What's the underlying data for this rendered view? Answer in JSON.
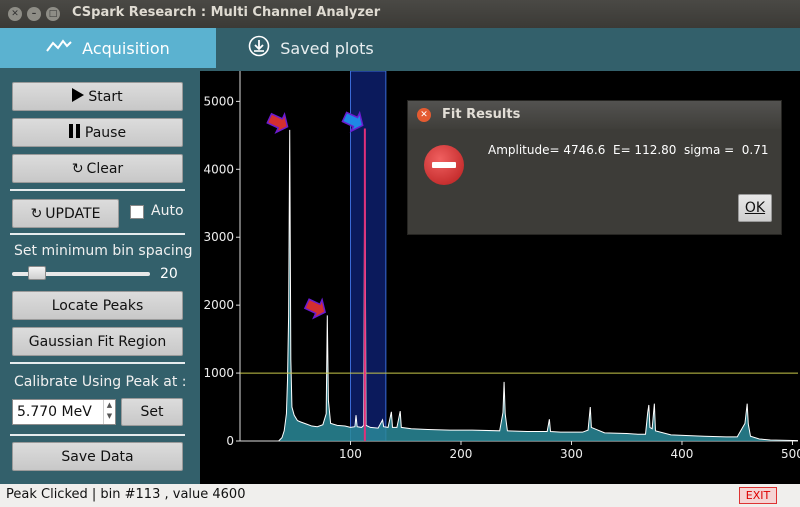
{
  "window": {
    "title": "CSpark Research : Multi Channel Analyzer"
  },
  "tabs": [
    {
      "label": "Acquisition",
      "icon": "line-chart-icon",
      "active": true
    },
    {
      "label": "Saved plots",
      "icon": "download-icon",
      "active": false
    }
  ],
  "sidebar": {
    "start_label": "Start",
    "pause_label": "Pause",
    "clear_label": "Clear",
    "update_label": "UPDATE",
    "auto_label": "Auto",
    "auto_checked": false,
    "bin_spacing_label": "Set minimum bin spacing",
    "bin_spacing_value": "20",
    "locate_peaks_label": "Locate Peaks",
    "gaussian_fit_label": "Gaussian Fit Region",
    "calibrate_label": "Calibrate Using Peak at :",
    "calibrate_value": "5.770 MeV",
    "set_label": "Set",
    "save_label": "Save Data"
  },
  "status": {
    "text": "Peak Clicked | bin #113 , value 4600",
    "exit_label": "EXIT"
  },
  "dialog": {
    "title": "Fit Results",
    "message": "Amplitude= 4746.6  E= 112.80  sigma =  0.71",
    "ok_label": "OK"
  },
  "chart_data": {
    "type": "line",
    "xlim": [
      0,
      505
    ],
    "ylim": [
      0,
      5300
    ],
    "xticks": [
      100,
      200,
      300,
      400,
      500
    ],
    "yticks": [
      0,
      1000,
      2000,
      3000,
      4000,
      5000
    ],
    "threshold_line": 1000,
    "selected_region": [
      100,
      132
    ],
    "clicked_bin": 113,
    "clicked_value": 4600,
    "series": [
      {
        "color": "#ffffff",
        "fill": "#2a8a99",
        "points": [
          [
            35,
            0
          ],
          [
            38,
            50
          ],
          [
            40,
            150
          ],
          [
            42,
            400
          ],
          [
            43,
            900
          ],
          [
            44,
            1850
          ],
          [
            45,
            4580
          ],
          [
            46,
            1200
          ],
          [
            47,
            500
          ],
          [
            49,
            380
          ],
          [
            52,
            300
          ],
          [
            55,
            280
          ],
          [
            60,
            250
          ],
          [
            65,
            220
          ],
          [
            70,
            210
          ],
          [
            75,
            240
          ],
          [
            78,
            400
          ],
          [
            79,
            1850
          ],
          [
            80,
            600
          ],
          [
            82,
            260
          ],
          [
            88,
            230
          ],
          [
            95,
            220
          ],
          [
            100,
            200
          ],
          [
            104,
            210
          ],
          [
            105,
            380
          ],
          [
            106,
            210
          ],
          [
            110,
            200
          ],
          [
            112,
            230
          ],
          [
            113,
            4600
          ],
          [
            114,
            230
          ],
          [
            118,
            200
          ],
          [
            125,
            190
          ],
          [
            129,
            310
          ],
          [
            130,
            210
          ],
          [
            134,
            200
          ],
          [
            137,
            430
          ],
          [
            138,
            200
          ],
          [
            142,
            200
          ],
          [
            145,
            440
          ],
          [
            146,
            200
          ],
          [
            155,
            180
          ],
          [
            170,
            170
          ],
          [
            190,
            160
          ],
          [
            210,
            160
          ],
          [
            235,
            150
          ],
          [
            238,
            420
          ],
          [
            239,
            870
          ],
          [
            240,
            400
          ],
          [
            242,
            150
          ],
          [
            260,
            140
          ],
          [
            278,
            140
          ],
          [
            280,
            320
          ],
          [
            281,
            140
          ],
          [
            290,
            130
          ],
          [
            300,
            130
          ],
          [
            310,
            130
          ],
          [
            315,
            160
          ],
          [
            317,
            500
          ],
          [
            318,
            200
          ],
          [
            330,
            120
          ],
          [
            350,
            110
          ],
          [
            360,
            100
          ],
          [
            367,
            100
          ],
          [
            369,
            420
          ],
          [
            370,
            530
          ],
          [
            371,
            200
          ],
          [
            373,
            180
          ],
          [
            375,
            550
          ],
          [
            376,
            150
          ],
          [
            390,
            90
          ],
          [
            420,
            70
          ],
          [
            440,
            60
          ],
          [
            450,
            60
          ],
          [
            457,
            260
          ],
          [
            459,
            550
          ],
          [
            460,
            250
          ],
          [
            462,
            70
          ],
          [
            470,
            30
          ],
          [
            480,
            15
          ],
          [
            505,
            5
          ]
        ]
      }
    ],
    "markers": [
      {
        "x": 45,
        "y": 4580,
        "color": "#d32f2f"
      },
      {
        "x": 79,
        "y": 1850,
        "color": "#d32f2f"
      },
      {
        "x": 113,
        "y": 4600,
        "color": "#1e88e5"
      }
    ]
  }
}
